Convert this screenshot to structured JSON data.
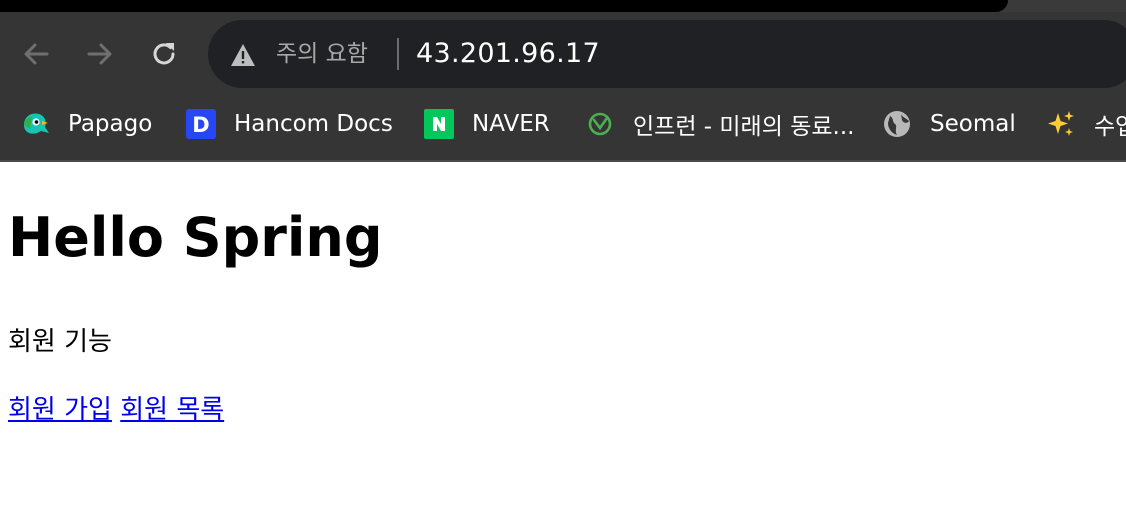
{
  "browser": {
    "security_text": "주의 요함",
    "url": "43.201.96.17"
  },
  "bookmarks": [
    {
      "label": "Papago",
      "icon": "papago-icon"
    },
    {
      "label": "Hancom Docs",
      "icon": "hancom-docs-icon"
    },
    {
      "label": "NAVER",
      "icon": "naver-icon"
    },
    {
      "label": "인프런 - 미래의 동료...",
      "icon": "inflearn-icon"
    },
    {
      "label": "Seomal",
      "icon": "globe-icon"
    },
    {
      "label": "수업",
      "icon": "sparkles-icon"
    }
  ],
  "page": {
    "heading": "Hello Spring",
    "section_label": "회원 기능",
    "links": {
      "signup": "회원 가입",
      "member_list": "회원 목록"
    }
  },
  "colors": {
    "toolbar_bg": "#353535",
    "omnibox_bg": "#202124",
    "link": "#0000ee",
    "hancom_blue": "#2747f5",
    "naver_green": "#03c75a",
    "inflearn_green": "#4caf50"
  }
}
